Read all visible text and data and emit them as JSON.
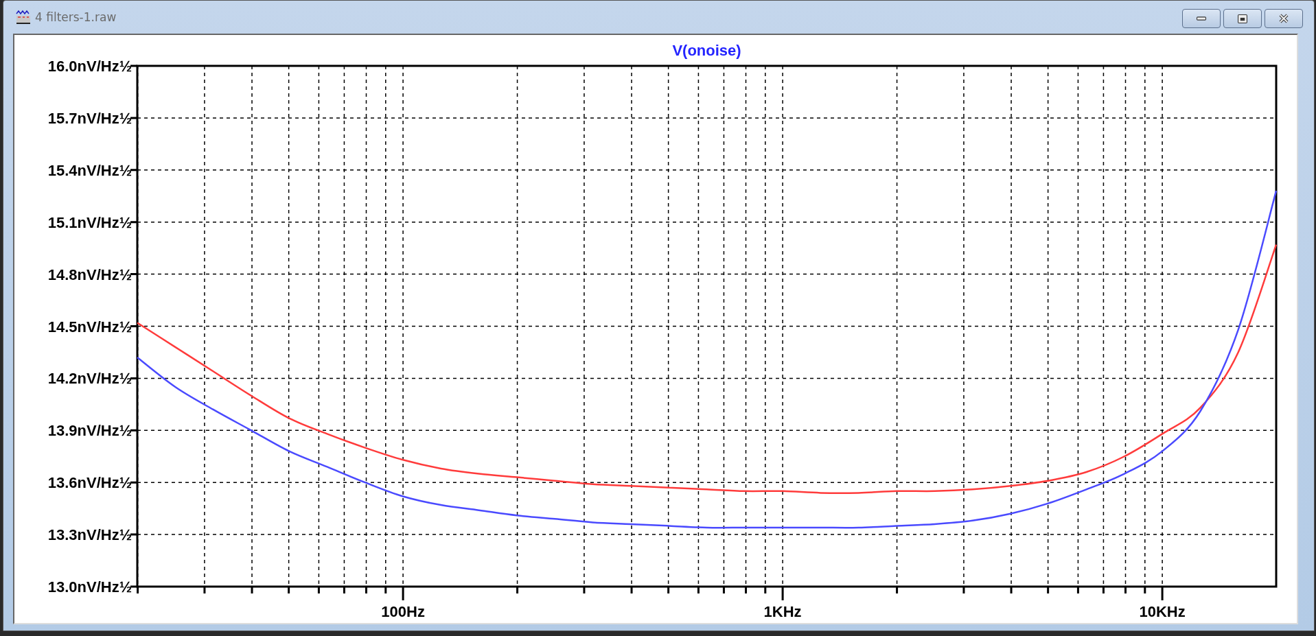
{
  "window": {
    "title": "4 filters-1.raw",
    "buttons": [
      {
        "kind": "minimize"
      },
      {
        "kind": "maximize"
      },
      {
        "kind": "close"
      }
    ]
  },
  "plot": {
    "chart_data": {
      "type": "line",
      "title": "V(onoise)",
      "categories": [
        null,
        null,
        null,
        null,
        null,
        null,
        null,
        "100Hz",
        null,
        null,
        null,
        null,
        null,
        null,
        null,
        null,
        null,
        "1KHz",
        null,
        null,
        null,
        null,
        null,
        null,
        null,
        null,
        null,
        "10KHz",
        null,
        null,
        null
      ],
      "series": [
        {
          "color": "#ff3b3b",
          "values": [
            14.52,
            14.38,
            14.24,
            14.1,
            13.97,
            13.88,
            13.8,
            13.73,
            13.68,
            13.65,
            13.63,
            13.61,
            13.59,
            13.58,
            13.57,
            13.56,
            13.55,
            13.55,
            13.54,
            13.54,
            13.55,
            13.55,
            13.56,
            13.58,
            13.61,
            13.66,
            13.75,
            13.88,
            14.03,
            14.35,
            14.97
          ]
        },
        {
          "color": "#4a4aff",
          "values": [
            14.32,
            14.15,
            14.02,
            13.9,
            13.78,
            13.69,
            13.6,
            13.52,
            13.47,
            13.44,
            13.41,
            13.39,
            13.37,
            13.36,
            13.35,
            13.34,
            13.34,
            13.34,
            13.34,
            13.34,
            13.35,
            13.36,
            13.38,
            13.42,
            13.48,
            13.56,
            13.65,
            13.78,
            14.01,
            14.48,
            15.28
          ]
        }
      ],
      "ylim": [
        13.0,
        16.0
      ],
      "grid": true,
      "yticks": [
        {
          "value": 16.0,
          "label": "16.0nV/Hz½"
        },
        {
          "value": 15.7,
          "label": "15.7nV/Hz½"
        },
        {
          "value": 15.4,
          "label": "15.4nV/Hz½"
        },
        {
          "value": 15.1,
          "label": "15.1nV/Hz½"
        },
        {
          "value": 14.8,
          "label": "14.8nV/Hz½"
        },
        {
          "value": 14.5,
          "label": "14.5nV/Hz½"
        },
        {
          "value": 14.2,
          "label": "14.2nV/Hz½"
        },
        {
          "value": 13.9,
          "label": "13.9nV/Hz½"
        },
        {
          "value": 13.6,
          "label": "13.6nV/Hz½"
        },
        {
          "value": 13.3,
          "label": "13.3nV/Hz½"
        },
        {
          "value": 13.0,
          "label": "13.0nV/Hz½"
        }
      ]
    }
  }
}
